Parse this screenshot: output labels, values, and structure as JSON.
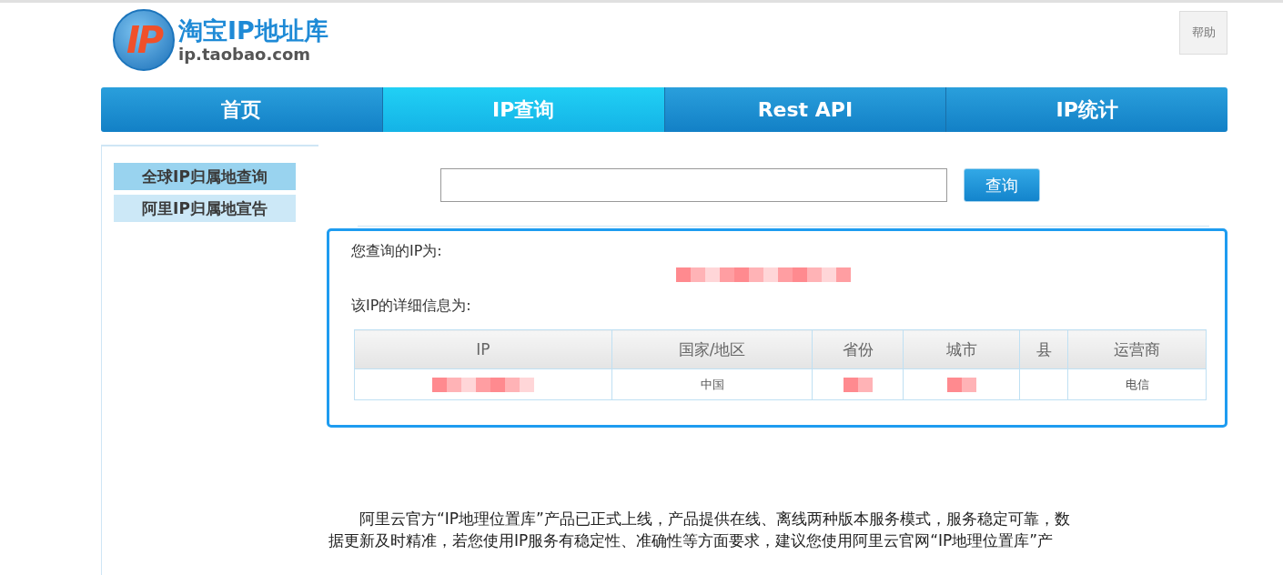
{
  "logo": {
    "mark": "IP",
    "title": "淘宝IP地址库",
    "domain": "ip.taobao.com"
  },
  "help_button": "帮助",
  "nav": [
    {
      "label": "首页",
      "selected": false
    },
    {
      "label": "IP查询",
      "selected": true
    },
    {
      "label": "Rest API",
      "selected": false
    },
    {
      "label": "IP统计",
      "selected": false
    }
  ],
  "sidebar": {
    "items": [
      {
        "label": "全球IP归属地查询",
        "selected": true
      },
      {
        "label": "阿里IP归属地宣告",
        "selected": false
      }
    ]
  },
  "search": {
    "button": "查询"
  },
  "result": {
    "ip_label": "您查询的IP为:",
    "ip_value": {
      "kind": "redacted"
    },
    "detail_label": "该IP的详细信息为:",
    "table": {
      "columns": [
        "IP",
        "国家/地区",
        "省份",
        "城市",
        "县",
        "运营商"
      ],
      "rows": [
        [
          {
            "kind": "redacted"
          },
          {
            "kind": "text",
            "text": "中国"
          },
          {
            "kind": "redacted"
          },
          {
            "kind": "redacted"
          },
          {
            "kind": "empty"
          },
          {
            "kind": "text",
            "text": "电信"
          }
        ]
      ]
    }
  },
  "notice": [
    "阿里云官方“IP地理位置库”产品已正式上线，产品提供在线、离线两种版本服务模式，服务稳定可靠，数",
    "据更新及时精准，若您使用IP服务有稳定性、准确性等方面要求，建议您使用阿里云官网“IP地理位置库”产"
  ]
}
